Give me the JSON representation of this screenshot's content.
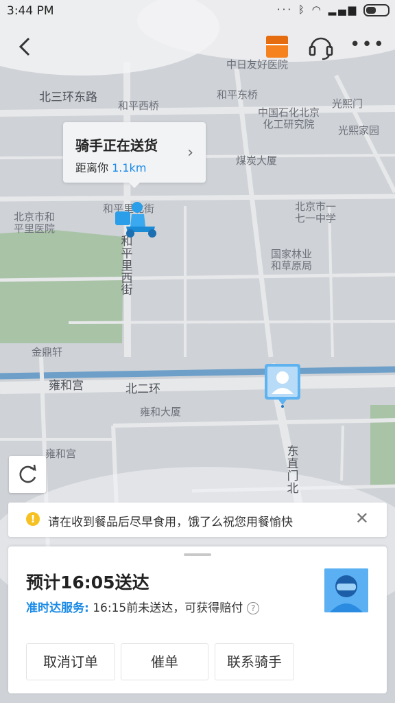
{
  "status_bar": {
    "time": "3:44 PM"
  },
  "map": {
    "labels": {
      "beisanhuan_east_rd": "北三环东路",
      "hepingxiqiao": "和平西桥",
      "hepingdongqiao": "和平东桥",
      "zhongri_hospital": "中日友好医院",
      "sinopec_inst": "中国石化北京\n化工研究院",
      "guangximen": "光熙门",
      "guangxijiayuan": "光熙家园",
      "meitan_building": "煤炭大厦",
      "hepingli_street": "和平里北街",
      "beijing_hepingli_hospital": "北京市和\n平里医院",
      "hepingli_west_street": "和平里西街",
      "beijing_171": "北京市一\n七一中学",
      "forestry_bureau": "国家林业\n和草原局",
      "jindingxuan": "金鼎轩",
      "yonghegong": "雍和宫",
      "beierhuan": "北二环",
      "yonghe_building": "雍和大厦",
      "yonghegong_2": "雍和宫",
      "dongzhimen_north": "东直门北"
    }
  },
  "header": {
    "back_icon": "chevron-left-icon",
    "gift_icon": "red-envelope-icon",
    "service_icon": "headset-icon",
    "more_icon": "more-dots-icon"
  },
  "rider_bubble": {
    "title": "骑手正在送货",
    "distance_prefix": "距离你",
    "distance": "1.1km"
  },
  "notice": {
    "text": "请在收到餐品后尽早食用，饿了么祝您用餐愉快"
  },
  "panel": {
    "eta": "预计16:05送达",
    "service_name": "准时达服务:",
    "service_text": " 16:15前未送达，可获得赔付",
    "help_mark": "?",
    "buttons": {
      "cancel": "取消订单",
      "urge": "催单",
      "contact": "联系骑手"
    }
  },
  "colors": {
    "accent_blue": "#1a8ae6",
    "brand_orange": "#f5811f",
    "warning_yellow": "#f6c223"
  }
}
